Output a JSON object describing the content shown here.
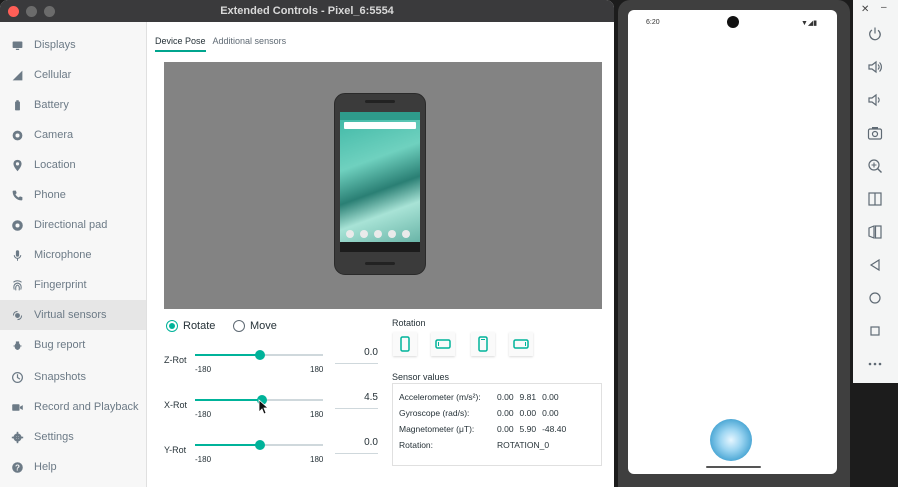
{
  "window": {
    "title": "Extended Controls - Pixel_6:5554"
  },
  "sidebar": {
    "items": [
      {
        "label": "Displays",
        "icon": "display-icon"
      },
      {
        "label": "Cellular",
        "icon": "cellular-icon"
      },
      {
        "label": "Battery",
        "icon": "battery-icon"
      },
      {
        "label": "Camera",
        "icon": "camera-icon"
      },
      {
        "label": "Location",
        "icon": "location-icon"
      },
      {
        "label": "Phone",
        "icon": "phone-icon"
      },
      {
        "label": "Directional pad",
        "icon": "dpad-icon"
      },
      {
        "label": "Microphone",
        "icon": "microphone-icon"
      },
      {
        "label": "Fingerprint",
        "icon": "fingerprint-icon"
      },
      {
        "label": "Virtual sensors",
        "icon": "sensors-icon",
        "active": true
      },
      {
        "label": "Bug report",
        "icon": "bug-icon"
      },
      {
        "label": "Snapshots",
        "icon": "snapshots-icon"
      },
      {
        "label": "Record and Playback",
        "icon": "record-icon"
      },
      {
        "label": "Settings",
        "icon": "gear-icon"
      },
      {
        "label": "Help",
        "icon": "help-icon"
      }
    ]
  },
  "tabs": [
    {
      "label": "Device Pose",
      "active": true
    },
    {
      "label": "Additional sensors",
      "active": false
    }
  ],
  "mode": {
    "rotate_label": "Rotate",
    "move_label": "Move",
    "selected": "Rotate"
  },
  "sliders": [
    {
      "label": "Z-Rot",
      "min": "-180",
      "max": "180",
      "value": "0.0"
    },
    {
      "label": "X-Rot",
      "min": "-180",
      "max": "180",
      "value": "4.5"
    },
    {
      "label": "Y-Rot",
      "min": "-180",
      "max": "180",
      "value": "0.0"
    }
  ],
  "rotation": {
    "heading": "Rotation",
    "buttons": [
      "portrait",
      "landscape",
      "reverse-portrait",
      "reverse-landscape"
    ]
  },
  "sensor_values": {
    "heading": "Sensor values",
    "rows": [
      {
        "label": "Accelerometer (m/s²):",
        "values": [
          "0.00",
          "9.81",
          "0.00"
        ]
      },
      {
        "label": "Gyroscope (rad/s):",
        "values": [
          "0.00",
          "0.00",
          "0.00"
        ]
      },
      {
        "label": "Magnetometer (μT):",
        "values": [
          "0.00",
          "5.90",
          "-48.40"
        ]
      },
      {
        "label": "Rotation:",
        "values": [
          "ROTATION_0"
        ]
      }
    ]
  },
  "emulator": {
    "time": "6:20",
    "status_icons": "▼◢▮"
  },
  "colors": {
    "accent": "#00b39a",
    "sidebar_bg": "#f7f7f7",
    "viewport_bg": "#838383"
  },
  "toolbar": {
    "close_glyph": "✕",
    "minimize_glyph": "–",
    "items": [
      "power-icon",
      "volume-up-icon",
      "volume-down-icon",
      "screenshot-icon",
      "zoom-icon",
      "fold-icon",
      "unfold-icon",
      "back-icon",
      "home-icon",
      "overview-icon",
      "more-icon"
    ]
  }
}
